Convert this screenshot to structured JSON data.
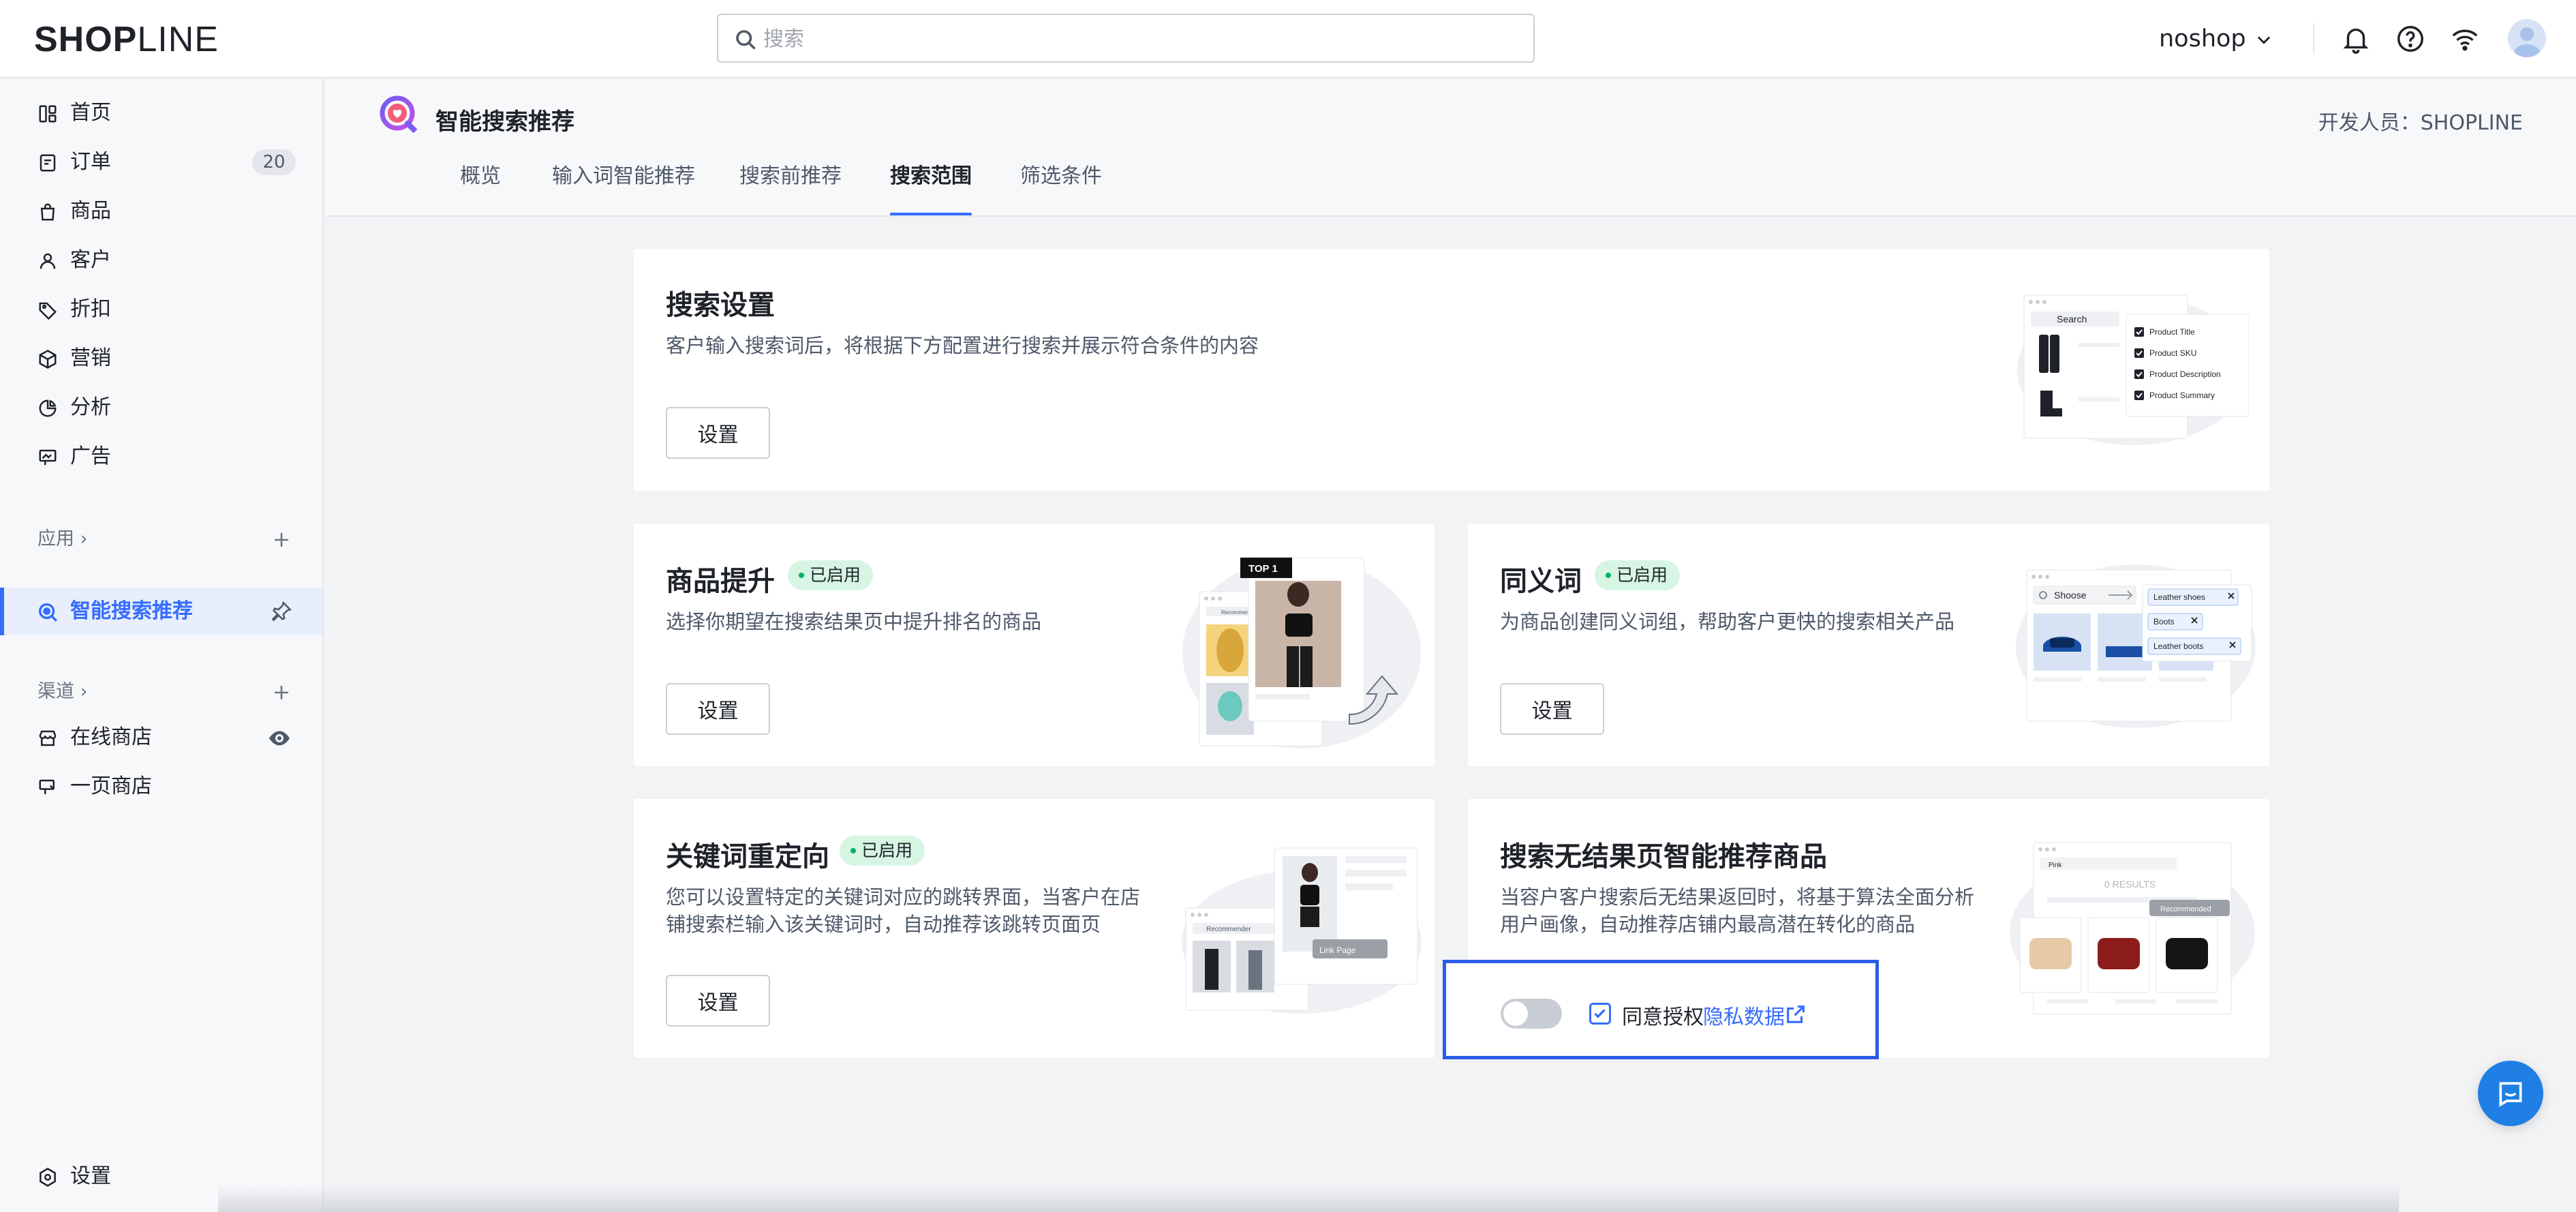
{
  "topbar": {
    "logo_bold": "SHOP",
    "logo_light": "LINE",
    "search_placeholder": "搜索",
    "shop_name": "noshop"
  },
  "sidebar": {
    "items": [
      {
        "label": "首页",
        "icon": "dashboard-icon"
      },
      {
        "label": "订单",
        "icon": "order-icon",
        "badge": "20"
      },
      {
        "label": "商品",
        "icon": "bag-icon"
      },
      {
        "label": "客户",
        "icon": "user-icon"
      },
      {
        "label": "折扣",
        "icon": "tag-icon"
      },
      {
        "label": "营销",
        "icon": "cube-icon"
      },
      {
        "label": "分析",
        "icon": "pie-chart-icon"
      },
      {
        "label": "广告",
        "icon": "billboard-icon"
      }
    ],
    "apps_section": "应用",
    "active_app": "智能搜索推荐",
    "channels_section": "渠道",
    "channels": [
      {
        "label": "在线商店",
        "icon": "store-icon"
      },
      {
        "label": "一页商店",
        "icon": "single-page-icon"
      }
    ],
    "settings": "设置"
  },
  "app": {
    "title": "智能搜索推荐",
    "developer": "开发人员：SHOPLINE",
    "tabs": [
      "概览",
      "输入词智能推荐",
      "搜索前推荐",
      "搜索范围",
      "筛选条件"
    ],
    "active_tab": "搜索范围"
  },
  "cards": {
    "search_settings": {
      "title": "搜索设置",
      "desc": "客户输入搜索词后，将根据下方配置进行搜索并展示符合条件的内容",
      "button": "设置",
      "illus": {
        "search_label": "Search",
        "options": [
          "Product Title",
          "Product SKU",
          "Product Description",
          "Product Summary"
        ]
      }
    },
    "boost": {
      "title": "商品提升",
      "status": "已启用",
      "desc": "选择你期望在搜索结果页中提升排名的商品",
      "button": "设置",
      "illus": {
        "badge": "TOP 1",
        "bar_label": "Recommender"
      }
    },
    "synonyms": {
      "title": "同义词",
      "status": "已启用",
      "desc": "为商品创建同义词组，帮助客户更快的搜索相关产品",
      "button": "设置",
      "illus": {
        "query": "Shoose",
        "chips": [
          "Leather shoes",
          "Boots",
          "Leather boots"
        ]
      }
    },
    "redirect": {
      "title": "关键词重定向",
      "status": "已启用",
      "desc_line1": "您可以设置特定的关键词对应的跳转界面，当客户在店",
      "desc_line2": "铺搜索栏输入该关键词时，自动推荐该跳转页面页",
      "button": "设置",
      "illus": {
        "bar_label": "Recommender",
        "link_label": "Link Page"
      }
    },
    "no_results": {
      "title": "搜索无结果页智能推荐商品",
      "desc_line1": "当容户客户搜索后无结果返回时，将基于算法全面分析",
      "desc_line2": "用户画像，自动推荐店铺内最高潜在转化的商品",
      "illus": {
        "query": "Pink",
        "results": "0 RESULTS",
        "tag": "Recommended"
      },
      "consent": {
        "agree": "同意授权",
        "privacy": "隐私数据",
        "toggle_on": false,
        "checked": true
      }
    }
  },
  "colors": {
    "accent": "#356dff",
    "status_bg": "#d6f5e3",
    "status_dot": "#00b36b",
    "highlight_border": "#2b5ce6",
    "chat": "#1f7fe5"
  }
}
